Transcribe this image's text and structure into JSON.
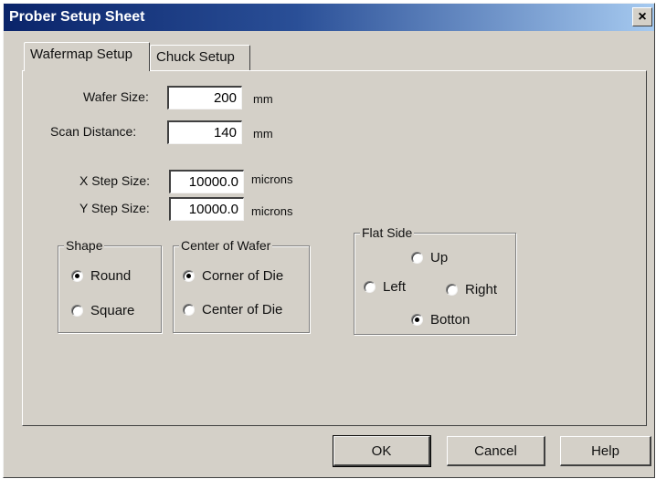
{
  "window": {
    "title": "Prober Setup Sheet",
    "close_glyph": "×"
  },
  "tabs": [
    {
      "label": "Wafermap Setup",
      "active": true
    },
    {
      "label": "Chuck Setup",
      "active": false
    }
  ],
  "fields": {
    "wafer_size": {
      "label": "Wafer Size:",
      "value": "200",
      "unit": "mm"
    },
    "scan_distance": {
      "label": "Scan Distance:",
      "value": "140",
      "unit": "mm"
    },
    "x_step": {
      "label": "X Step Size:",
      "value": "10000.0",
      "unit": "microns"
    },
    "y_step": {
      "label": "Y Step Size:",
      "value": "10000.0",
      "unit": "microns"
    }
  },
  "shape": {
    "title": "Shape",
    "options": [
      {
        "label": "Round",
        "selected": true
      },
      {
        "label": "Square",
        "selected": false
      }
    ]
  },
  "center": {
    "title": "Center of Wafer",
    "options": [
      {
        "label": "Corner of Die",
        "selected": true
      },
      {
        "label": "Center of Die",
        "selected": false
      }
    ]
  },
  "flat_side": {
    "title": "Flat Side",
    "options": {
      "up": {
        "label": "Up",
        "selected": false
      },
      "left": {
        "label": "Left",
        "selected": false
      },
      "right": {
        "label": "Right",
        "selected": false
      },
      "bottom": {
        "label": "Botton",
        "selected": true
      }
    }
  },
  "buttons": {
    "ok": "OK",
    "cancel": "Cancel",
    "help": "Help"
  }
}
